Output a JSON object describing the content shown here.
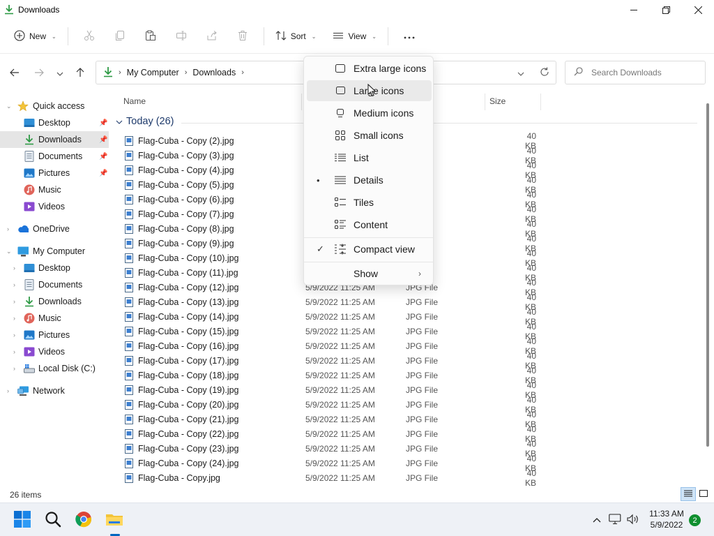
{
  "window": {
    "title": "Downloads"
  },
  "toolbar": {
    "new_label": "New",
    "sort_label": "Sort",
    "view_label": "View"
  },
  "address": {
    "crumbs": [
      "My Computer",
      "Downloads"
    ]
  },
  "search": {
    "placeholder": "Search Downloads"
  },
  "sidebar": {
    "quick_access": "Quick access",
    "quick_items": [
      "Desktop",
      "Downloads",
      "Documents",
      "Pictures",
      "Music",
      "Videos"
    ],
    "onedrive": "OneDrive",
    "my_computer": "My Computer",
    "computer_items": [
      "Desktop",
      "Documents",
      "Downloads",
      "Music",
      "Pictures",
      "Videos",
      "Local Disk (C:)"
    ],
    "network": "Network"
  },
  "columns": {
    "name": "Name",
    "size": "Size"
  },
  "group": {
    "label": "Today (26)"
  },
  "files": [
    {
      "name": "Flag-Cuba - Copy (2).jpg",
      "date": "",
      "type": "",
      "size": "40 KB"
    },
    {
      "name": "Flag-Cuba - Copy (3).jpg",
      "date": "",
      "type": "",
      "size": "40 KB"
    },
    {
      "name": "Flag-Cuba - Copy (4).jpg",
      "date": "",
      "type": "",
      "size": "40 KB"
    },
    {
      "name": "Flag-Cuba - Copy (5).jpg",
      "date": "",
      "type": "",
      "size": "40 KB"
    },
    {
      "name": "Flag-Cuba - Copy (6).jpg",
      "date": "",
      "type": "",
      "size": "40 KB"
    },
    {
      "name": "Flag-Cuba - Copy (7).jpg",
      "date": "",
      "type": "",
      "size": "40 KB"
    },
    {
      "name": "Flag-Cuba - Copy (8).jpg",
      "date": "",
      "type": "",
      "size": "40 KB"
    },
    {
      "name": "Flag-Cuba - Copy (9).jpg",
      "date": "",
      "type": "",
      "size": "40 KB"
    },
    {
      "name": "Flag-Cuba - Copy (10).jpg",
      "date": "",
      "type": "",
      "size": "40 KB"
    },
    {
      "name": "Flag-Cuba - Copy (11).jpg",
      "date": "",
      "type": "",
      "size": "40 KB"
    },
    {
      "name": "Flag-Cuba - Copy (12).jpg",
      "date": "5/9/2022 11:25 AM",
      "type": "JPG File",
      "size": "40 KB"
    },
    {
      "name": "Flag-Cuba - Copy (13).jpg",
      "date": "5/9/2022 11:25 AM",
      "type": "JPG File",
      "size": "40 KB"
    },
    {
      "name": "Flag-Cuba - Copy (14).jpg",
      "date": "5/9/2022 11:25 AM",
      "type": "JPG File",
      "size": "40 KB"
    },
    {
      "name": "Flag-Cuba - Copy (15).jpg",
      "date": "5/9/2022 11:25 AM",
      "type": "JPG File",
      "size": "40 KB"
    },
    {
      "name": "Flag-Cuba - Copy (16).jpg",
      "date": "5/9/2022 11:25 AM",
      "type": "JPG File",
      "size": "40 KB"
    },
    {
      "name": "Flag-Cuba - Copy (17).jpg",
      "date": "5/9/2022 11:25 AM",
      "type": "JPG File",
      "size": "40 KB"
    },
    {
      "name": "Flag-Cuba - Copy (18).jpg",
      "date": "5/9/2022 11:25 AM",
      "type": "JPG File",
      "size": "40 KB"
    },
    {
      "name": "Flag-Cuba - Copy (19).jpg",
      "date": "5/9/2022 11:25 AM",
      "type": "JPG File",
      "size": "40 KB"
    },
    {
      "name": "Flag-Cuba - Copy (20).jpg",
      "date": "5/9/2022 11:25 AM",
      "type": "JPG File",
      "size": "40 KB"
    },
    {
      "name": "Flag-Cuba - Copy (21).jpg",
      "date": "5/9/2022 11:25 AM",
      "type": "JPG File",
      "size": "40 KB"
    },
    {
      "name": "Flag-Cuba - Copy (22).jpg",
      "date": "5/9/2022 11:25 AM",
      "type": "JPG File",
      "size": "40 KB"
    },
    {
      "name": "Flag-Cuba - Copy (23).jpg",
      "date": "5/9/2022 11:25 AM",
      "type": "JPG File",
      "size": "40 KB"
    },
    {
      "name": "Flag-Cuba - Copy (24).jpg",
      "date": "5/9/2022 11:25 AM",
      "type": "JPG File",
      "size": "40 KB"
    },
    {
      "name": "Flag-Cuba - Copy.jpg",
      "date": "5/9/2022 11:25 AM",
      "type": "JPG File",
      "size": "40 KB"
    }
  ],
  "status": {
    "item_count": "26 items"
  },
  "view_menu": {
    "items": [
      "Extra large icons",
      "Large icons",
      "Medium icons",
      "Small icons",
      "List",
      "Details",
      "Tiles",
      "Content"
    ],
    "selected": "Details",
    "compact_view": "Compact view",
    "compact_checked": true,
    "show": "Show"
  },
  "taskbar": {
    "time": "11:33 AM",
    "date": "5/9/2022",
    "notifications": "2"
  },
  "colors": {
    "accent": "#0067c0",
    "download_green": "#2e9a45",
    "folder_yellow": "#f3c43a"
  }
}
